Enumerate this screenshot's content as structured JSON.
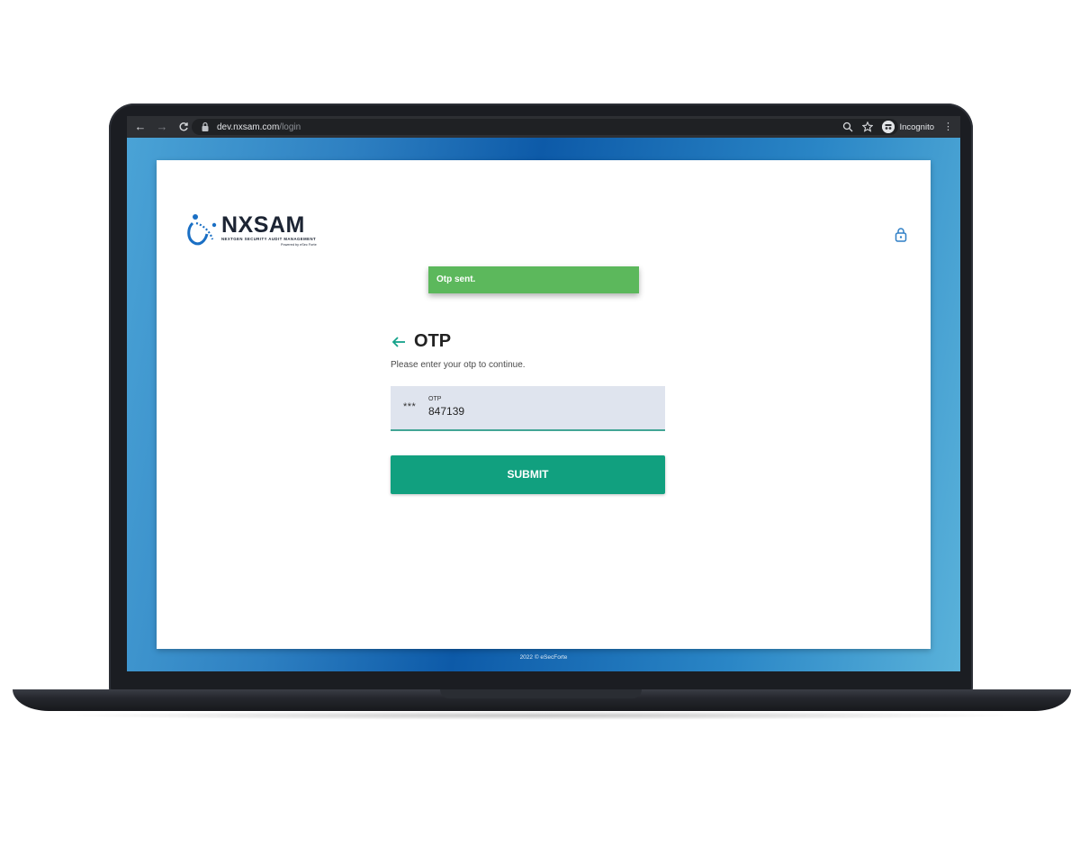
{
  "browser": {
    "url_host": "dev.nxsam.com",
    "url_path": "/login",
    "profile_label": "Incognito",
    "icons": [
      "back-arrow-icon",
      "forward-arrow-icon",
      "reload-icon",
      "lock-icon",
      "search-icon",
      "star-icon",
      "incognito-icon",
      "kebab-menu-icon"
    ]
  },
  "brand": {
    "name": "NXSAM",
    "tagline": "NEXTGEN SECURITY AUDIT MANAGEMENT",
    "powered_by": "Powered by eSec Forte",
    "color": "#1a6fc4"
  },
  "toast": {
    "message": "Otp sent.",
    "color": "#5cb85c"
  },
  "otp": {
    "title": "OTP",
    "subtitle": "Please enter your otp to continue.",
    "field_label": "OTP",
    "masked_icon": "***",
    "value": "847139"
  },
  "submit": {
    "label": "SUBMIT",
    "color": "#11a07f"
  },
  "footer": {
    "text": "2022 © eSecForte"
  }
}
